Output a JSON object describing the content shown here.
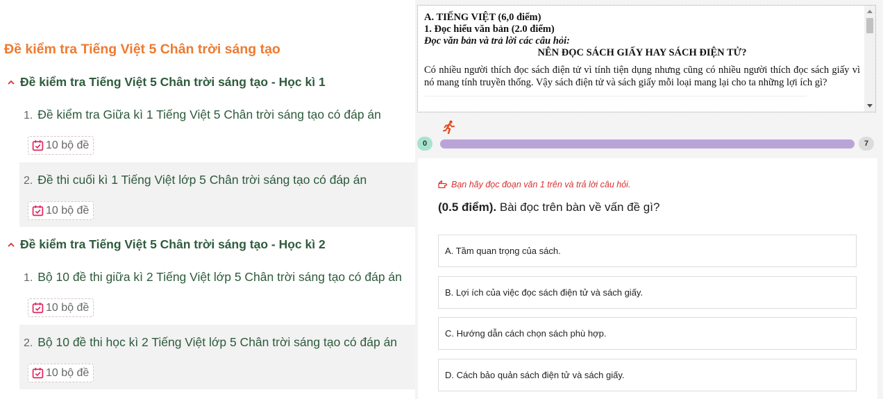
{
  "left": {
    "main_title": "Đề kiểm tra Tiếng Việt 5 Chân trời sáng tạo",
    "sections": [
      {
        "title": "Đề kiểm tra Tiếng Việt 5 Chân trời sáng tạo - Học kì 1",
        "items": [
          {
            "num": "1.",
            "title": "Đề kiểm tra Giữa kì 1 Tiếng Việt 5 Chân trời sáng tạo có đáp án",
            "badge": "10 bộ đề"
          },
          {
            "num": "2.",
            "title": "Đề thi cuối kì 1 Tiếng Việt lớp 5 Chân trời sáng tạo có đáp án",
            "badge": "10 bộ đề"
          }
        ]
      },
      {
        "title": "Đề kiểm tra Tiếng Việt 5 Chân trời sáng tạo - Học kì 2",
        "items": [
          {
            "num": "1.",
            "title": "Bộ 10 đề thi giữa kì 2 Tiếng Việt lớp 5 Chân trời sáng tạo có đáp án",
            "badge": "10 bộ đề"
          },
          {
            "num": "2.",
            "title": "Bộ 10 đề thi học kì 2 Tiếng Việt lớp 5 Chân trời sáng tạo có đáp án",
            "badge": "10 bộ đề"
          }
        ]
      }
    ]
  },
  "passage": {
    "line1": "A. TIẾNG VIỆT (6,0 điểm)",
    "line2": "1. Đọc hiểu văn bản (2.0 điểm)",
    "line3": "Đọc văn bản và trả lời các câu hỏi:",
    "heading": "NÊN ĐỌC SÁCH GIẤY HAY SÁCH ĐIỆN TỬ?",
    "paragraph": "Có nhiều người thích đọc sách điện tử vì tính tiện dụng nhưng cũng có nhiều người thích đọc sách giấy vì nó mang tính truyền thống. Vậy sách điện tử và sách giấy mỗi loại mang lại cho ta những lợi ích gì?"
  },
  "progress": {
    "start": "0",
    "end": "7",
    "fraction": 1.0
  },
  "question": {
    "hint": "Bạn hãy đọc đoạn văn 1 trên và trả lời câu hỏi.",
    "points": "(0.5 điểm).",
    "text": "Bài đọc trên bàn về vấn đề gì?",
    "options": [
      "A. Tầm quan trọng của sách.",
      "B. Lợi ích của việc đọc sách điện tử và sách giấy.",
      "C. Hướng dẫn cách chọn sách phù hợp.",
      "D. Cách bảo quản sách điện tử và sách giấy."
    ]
  },
  "colors": {
    "main_title": "#ee7a2f",
    "section_title": "#2f5b3e",
    "hint": "#d93030",
    "progress_track": "#b9a4d8",
    "progress_start": "#a7e3cf",
    "badge_icon": "#e0245e"
  },
  "icons": {
    "chevron": "chevron-up-icon",
    "badge": "calendar-check-icon",
    "runner": "running-person-icon",
    "hint": "pointing-hand-icon"
  }
}
